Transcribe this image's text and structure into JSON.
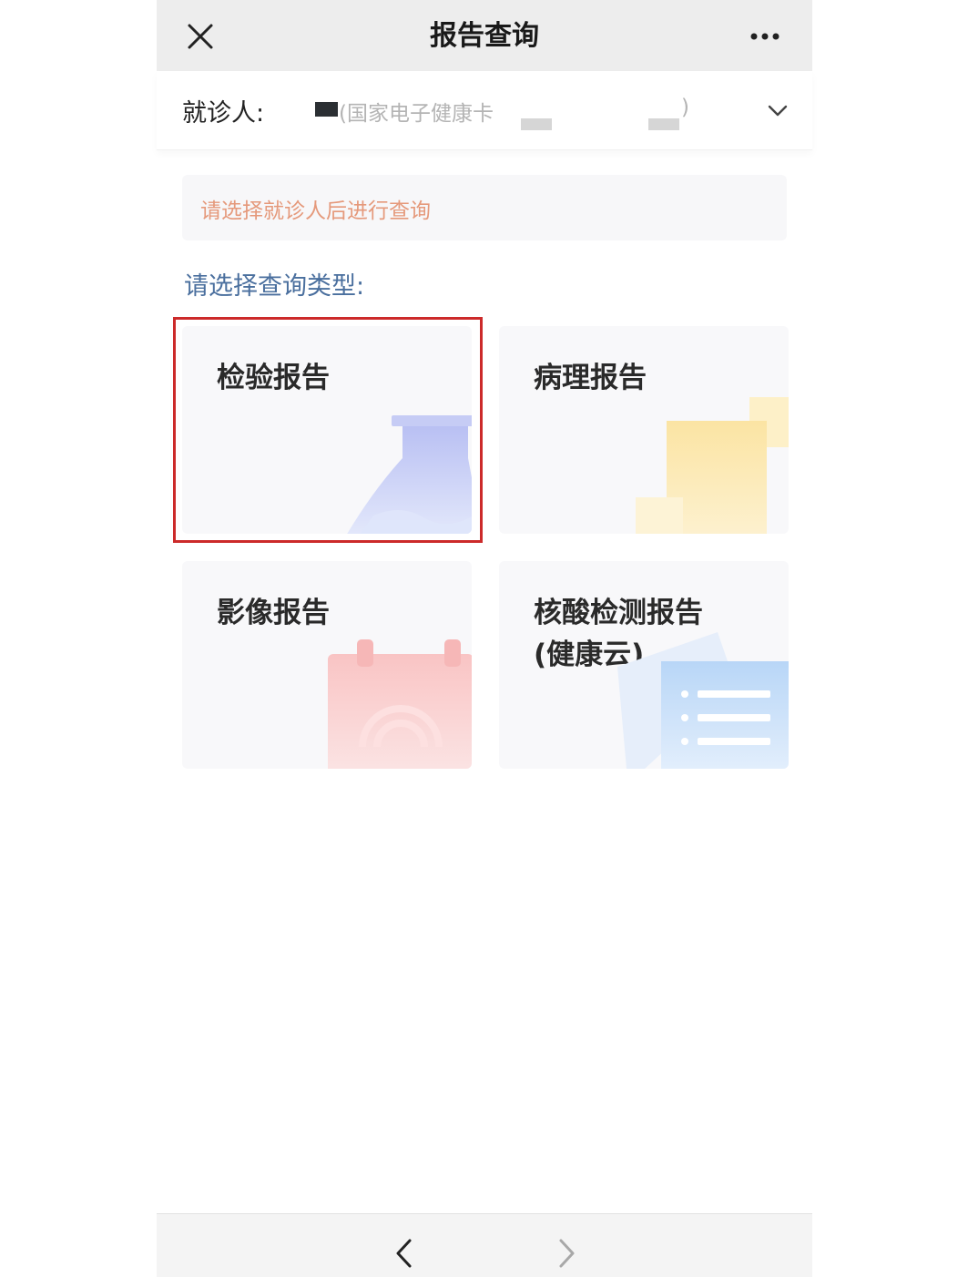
{
  "header": {
    "title": "报告查询",
    "close_icon": "close-icon",
    "more_icon": "more-dots-icon"
  },
  "patient": {
    "label": "就诊人:",
    "value": "(国家电子健康卡",
    "close_paren": ")",
    "dropdown_icon": "chevron-down-icon"
  },
  "hint": {
    "text": "请选择就诊人后进行查询",
    "color": "#e5997b"
  },
  "select_type_label": "请选择查询类型:",
  "cards": [
    {
      "title": "检验报告",
      "icon": "flask-icon",
      "selected": true
    },
    {
      "title": "病理报告",
      "icon": "document-stack-icon"
    },
    {
      "title": "影像报告",
      "icon": "calendar-scan-icon"
    },
    {
      "title_line1": "核酸检测报告",
      "title_line2": "(健康云)",
      "icon": "list-document-icon"
    }
  ],
  "bottom_nav": {
    "back_icon": "chevron-left-icon",
    "forward_icon": "chevron-right-icon"
  },
  "colors": {
    "highlight": "#cc2a2a",
    "accent_blue": "#4a6f9e"
  }
}
